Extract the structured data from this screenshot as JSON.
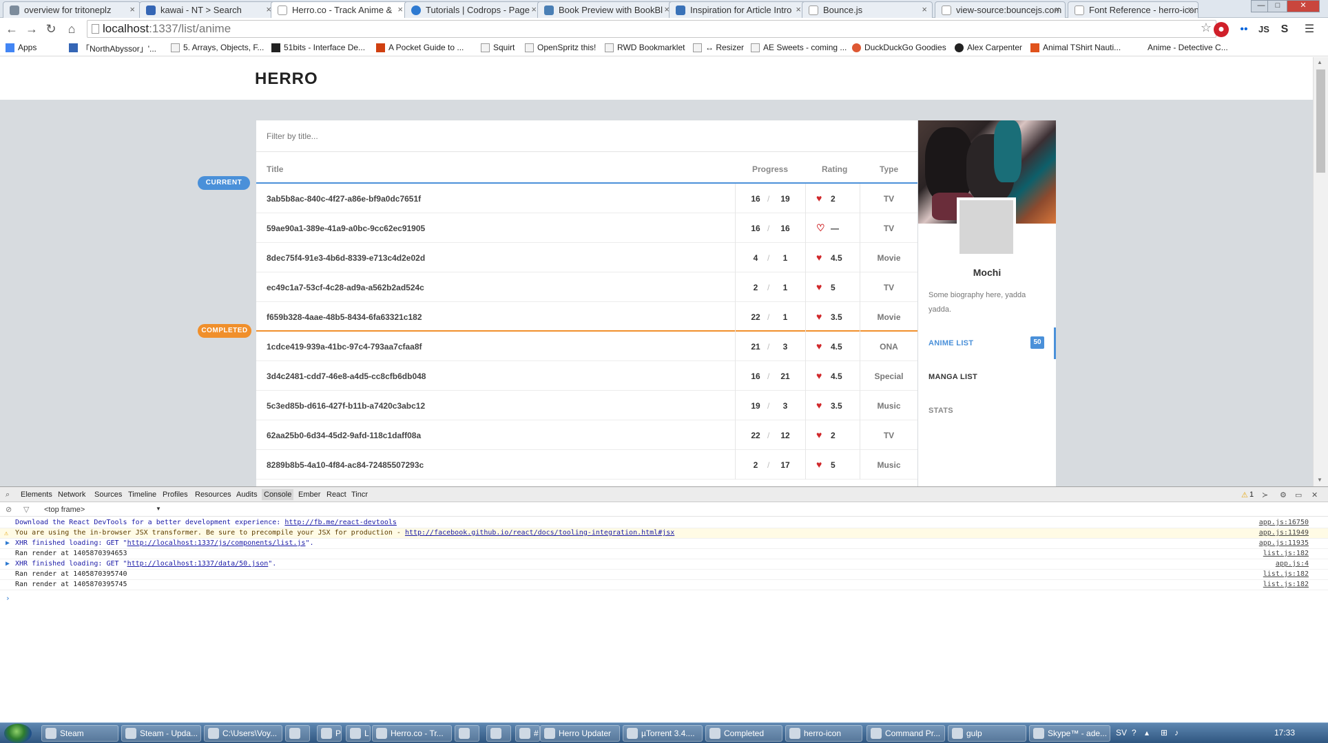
{
  "browser": {
    "tabs": [
      {
        "label": "overview for tritoneplz"
      },
      {
        "label": "kawai - NT > Search"
      },
      {
        "label": "Herro.co - Track Anime &",
        "active": true
      },
      {
        "label": "Tutorials | Codrops - Page"
      },
      {
        "label": "Book Preview with BookBl"
      },
      {
        "label": "Inspiration for Article Intro"
      },
      {
        "label": "Bounce.js"
      },
      {
        "label": "view-source:bouncejs.com"
      },
      {
        "label": "Font Reference - herro-icon"
      }
    ],
    "window_controls": {
      "minimize": "—",
      "maximize": "□",
      "close": "✕"
    },
    "url_host": "localhost",
    "url_rest": ":1337/list/anime",
    "bookmarks": [
      "Apps",
      "「NorthAbyssor」'...",
      "5. Arrays, Objects, F...",
      "51bits - Interface De...",
      "A Pocket Guide to ...",
      "Squirt",
      "OpenSpritz this!",
      "RWD Bookmarklet",
      "↔ Resizer",
      "AE Sweets - coming ...",
      "DuckDuckGo Goodies",
      "Alex Carpenter",
      "Animal TShirt Nauti...",
      "Anime - Detective C..."
    ]
  },
  "app": {
    "logo": "HERRO",
    "filter_placeholder": "Filter by title...",
    "columns": {
      "title": "Title",
      "progress": "Progress",
      "rating": "Rating",
      "type": "Type"
    },
    "badges": {
      "current": "CURRENT",
      "completed": "COMPLETED"
    },
    "colors": {
      "accent": "#4a90d9",
      "completed": "#f08f2b",
      "heart": "#d0282b"
    },
    "rows": [
      {
        "title": "3ab5b8ac-840c-4f27-a86e-bf9a0dc7651f",
        "cur": "16",
        "tot": "19",
        "heart": "filled",
        "rating": "2",
        "type": "TV"
      },
      {
        "title": "59ae90a1-389e-41a9-a0bc-9cc62ec91905",
        "cur": "16",
        "tot": "16",
        "heart": "empty",
        "rating": "—",
        "type": "TV"
      },
      {
        "title": "8dec75f4-91e3-4b6d-8339-e713c4d2e02d",
        "cur": "4",
        "tot": "1",
        "heart": "filled",
        "rating": "4.5",
        "type": "Movie"
      },
      {
        "title": "ec49c1a7-53cf-4c28-ad9a-a562b2ad524c",
        "cur": "2",
        "tot": "1",
        "heart": "filled",
        "rating": "5",
        "type": "TV"
      },
      {
        "title": "f659b328-4aae-48b5-8434-6fa63321c182",
        "cur": "22",
        "tot": "1",
        "heart": "filled",
        "rating": "3.5",
        "type": "Movie"
      },
      {
        "title": "1cdce419-939a-41bc-97c4-793aa7cfaa8f",
        "cur": "21",
        "tot": "3",
        "heart": "filled",
        "rating": "4.5",
        "type": "ONA"
      },
      {
        "title": "3d4c2481-cdd7-46e8-a4d5-cc8cfb6db048",
        "cur": "16",
        "tot": "21",
        "heart": "filled",
        "rating": "4.5",
        "type": "Special"
      },
      {
        "title": "5c3ed85b-d616-427f-b11b-a7420c3abc12",
        "cur": "19",
        "tot": "3",
        "heart": "filled",
        "rating": "3.5",
        "type": "Music"
      },
      {
        "title": "62aa25b0-6d34-45d2-9afd-118c1daff08a",
        "cur": "22",
        "tot": "12",
        "heart": "filled",
        "rating": "2",
        "type": "TV"
      },
      {
        "title": "8289b8b5-4a10-4f84-ac84-72485507293c",
        "cur": "2",
        "tot": "17",
        "heart": "filled",
        "rating": "5",
        "type": "Music"
      }
    ],
    "profile": {
      "username": "Mochi",
      "bio": "Some biography here, yadda yadda.",
      "nav": {
        "anime_list": "ANIME LIST",
        "anime_count": "50",
        "manga_list": "MANGA LIST",
        "stats": "STATS"
      }
    }
  },
  "devtools": {
    "tabs": [
      "Elements",
      "Network",
      "Sources",
      "Timeline",
      "Profiles",
      "Resources",
      "Audits",
      "Console",
      "Ember",
      "React",
      "Tincr"
    ],
    "active_tab": "Console",
    "warn_count": "1",
    "frame": "<top frame>",
    "lines": [
      {
        "text": "Download the React DevTools for a better development experience: ",
        "link": "http://fb.me/react-devtools",
        "src": "app.js:16750",
        "kind": "info"
      },
      {
        "text": "You are using the in-browser JSX transformer. Be sure to precompile your JSX for production - ",
        "link": "http://facebook.github.io/react/docs/tooling-integration.html#jsx",
        "src": "app.js:11949",
        "kind": "warn"
      },
      {
        "text": "XHR finished loading: GET \"",
        "link": "http://localhost:1337/js/components/list.js",
        "tail": "\".",
        "src": "app.js:11935",
        "kind": "xhr"
      },
      {
        "text": "Ran render at 1405870394653",
        "src": "list.js:182",
        "kind": "log"
      },
      {
        "text": "XHR finished loading: GET \"",
        "link": "http://localhost:1337/data/50.json",
        "tail": "\".",
        "src": "app.js:4",
        "kind": "xhr"
      },
      {
        "text": "Ran render at 1405870395740",
        "src": "list.js:182",
        "kind": "log"
      },
      {
        "text": "Ran render at 1405870395745",
        "src": "list.js:182",
        "kind": "log"
      }
    ]
  },
  "taskbar": {
    "items": [
      "Steam",
      "Steam - Upda...",
      "C:\\Users\\Voy...",
      "",
      "Ps",
      "L",
      "Herro.co - Tr...",
      "",
      "",
      "#",
      "Herro Updater",
      "µTorrent 3.4....",
      "Completed",
      "herro-icon",
      "Command Pr...",
      "gulp",
      "Skype™ - ade..."
    ],
    "lang": "SV",
    "clock": "17:33"
  }
}
